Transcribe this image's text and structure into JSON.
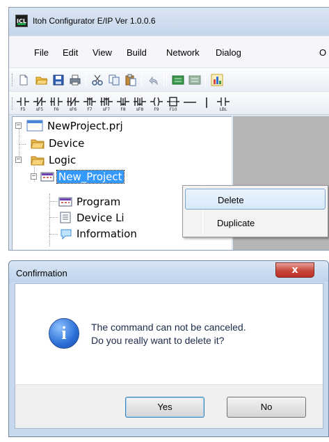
{
  "window": {
    "title": "Itoh Configurator E/IP Ver 1.0.0.6",
    "app_icon_text": "ICL"
  },
  "menu": [
    "File",
    "Edit",
    "View",
    "Build",
    "Network",
    "Dialog",
    "O"
  ],
  "toolbar_ladder": {
    "labels": [
      "F5",
      "sF5",
      "F6",
      "sF6",
      "F7",
      "sF7",
      "F8",
      "sF8",
      "F9",
      "F10",
      "",
      "",
      "LBL"
    ]
  },
  "tree": {
    "root": "NewProject.prj",
    "device": "Device",
    "logic": "Logic",
    "project": "New_Project",
    "program": "Program",
    "device_list": "Device Li",
    "information": "Information"
  },
  "context_menu": {
    "items": [
      "Delete",
      "Duplicate"
    ]
  },
  "dialog": {
    "title": "Confirmation",
    "close_glyph": "x",
    "message_line1": "The command can not be canceled.",
    "message_line2": "Do you really want to delete it?",
    "yes_label": "Yes",
    "no_label": "No",
    "icon": "info-icon"
  },
  "colors": {
    "selection": "#3399ff",
    "titlebar": "#c4d5ea",
    "close_button": "#c8463a",
    "info_icon": "#2a6fd6"
  }
}
